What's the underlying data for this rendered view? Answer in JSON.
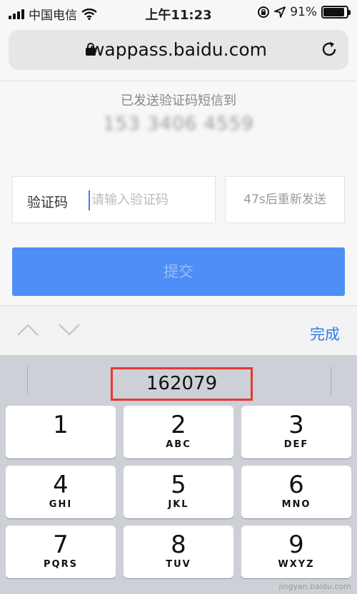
{
  "status_bar": {
    "carrier": "中国电信",
    "time": "上午11:23",
    "battery_percent": "91%",
    "battery_level": 0.91
  },
  "browser": {
    "url": "wappass.baidu.com"
  },
  "page": {
    "sent_text": "已发送验证码短信到",
    "phone_masked": "153 3406 4559",
    "code_label": "验证码",
    "code_placeholder": "请输入验证码",
    "resend_label": "47s后重新发送",
    "submit_label": "提交"
  },
  "keyboard": {
    "done_label": "完成",
    "suggestion": "162079",
    "keys": [
      {
        "num": "1",
        "letters": ""
      },
      {
        "num": "2",
        "letters": "ABC"
      },
      {
        "num": "3",
        "letters": "DEF"
      },
      {
        "num": "4",
        "letters": "GHI"
      },
      {
        "num": "5",
        "letters": "JKL"
      },
      {
        "num": "6",
        "letters": "MNO"
      },
      {
        "num": "7",
        "letters": "PQRS"
      },
      {
        "num": "8",
        "letters": "TUV"
      },
      {
        "num": "9",
        "letters": "WXYZ"
      }
    ],
    "watermark": "jingyan.baidu.com"
  }
}
